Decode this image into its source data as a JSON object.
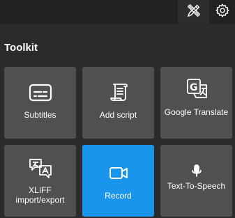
{
  "header": {
    "active_tool_icon": "pencil-cross-icon",
    "settings_icon": "gear-icon"
  },
  "toolkit": {
    "title": "Toolkit",
    "tiles": [
      {
        "label": "Subtitles",
        "icon": "subtitles-icon"
      },
      {
        "label": "Add script",
        "icon": "script-scroll-icon"
      },
      {
        "label": "Google Translate",
        "icon": "google-translate-icon"
      },
      {
        "label": "XLIFF import/export",
        "icon": "translate-chat-icon"
      },
      {
        "label": "Record",
        "icon": "video-camera-icon",
        "active": true
      },
      {
        "label": "Text-To-Speech",
        "icon": "microphone-icon"
      }
    ]
  },
  "colors": {
    "background": "#2b2b2b",
    "tile": "#505050",
    "active_tile": "#1a95ec"
  }
}
